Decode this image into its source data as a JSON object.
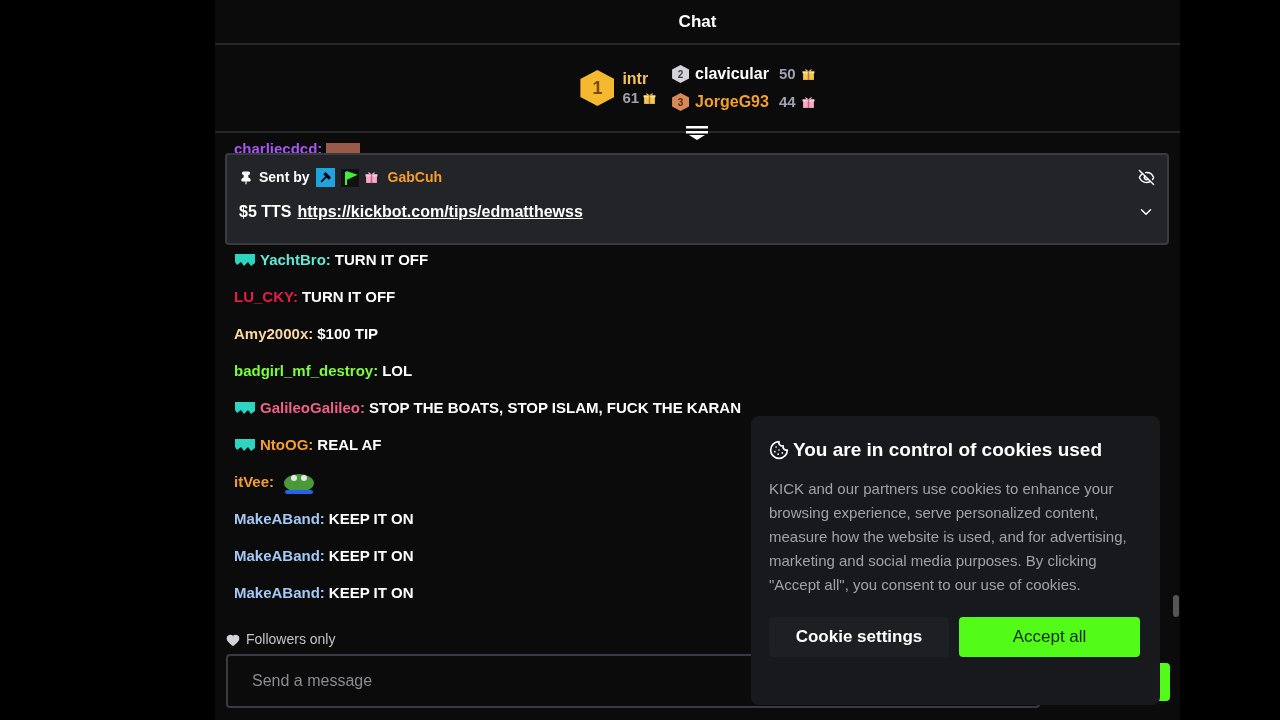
{
  "header": {
    "title": "Chat"
  },
  "leaderboard": [
    {
      "rank": "1",
      "name": "intr",
      "count": "61",
      "color": "#f5c451"
    },
    {
      "rank": "2",
      "name": "clavicular",
      "count": "50",
      "color": "#ffffff"
    },
    {
      "rank": "3",
      "name": "JorgeG93",
      "count": "44",
      "color": "#f59e2b"
    }
  ],
  "pinned": {
    "sent_by": "Sent by",
    "user": "GabCuh",
    "message": "$5 TTS",
    "link": "https://kickbot.com/tips/edmatthewss"
  },
  "hidden_message": {
    "user": "charliecdcd:",
    "color": "#a855f7"
  },
  "messages": [
    {
      "kind": "text",
      "badge": true,
      "user": "YachtBro:",
      "color": "#5eead4",
      "text": "TURN IT OFF"
    },
    {
      "kind": "text",
      "badge": false,
      "user": "LU_CKY:",
      "color": "#e11d48",
      "text": "TURN IT OFF"
    },
    {
      "kind": "text",
      "badge": false,
      "user": "Amy2000x:",
      "color": "#fcd9a0",
      "text": "$100 TIP"
    },
    {
      "kind": "text",
      "badge": false,
      "user": "badgirl_mf_destroy:",
      "color": "#7cfc3a",
      "text": "LOL"
    },
    {
      "kind": "text",
      "badge": true,
      "user": "GalileoGalileo:",
      "color": "#f0608a",
      "text": "STOP THE BOATS, STOP ISLAM, FUCK THE KARAN"
    },
    {
      "kind": "text",
      "badge": true,
      "user": "NtoOG:",
      "color": "#f59e2b",
      "text": "REAL AF"
    },
    {
      "kind": "emote",
      "badge": false,
      "user": "itVee:",
      "color": "#f59e2b"
    },
    {
      "kind": "text",
      "badge": false,
      "user": "MakeABand:",
      "color": "#a5c8f5",
      "text": "KEEP IT ON"
    },
    {
      "kind": "text",
      "badge": false,
      "user": "MakeABand:",
      "color": "#a5c8f5",
      "text": "KEEP IT ON"
    },
    {
      "kind": "text",
      "badge": false,
      "user": "MakeABand:",
      "color": "#a5c8f5",
      "text": "KEEP IT ON"
    }
  ],
  "chat_mode": "Followers only",
  "input": {
    "placeholder": "Send a message"
  },
  "cookie_dialog": {
    "title": "You are in control of cookies used",
    "body": "KICK and our partners use cookies to enhance your browsing experience, serve personalized content, measure how the website is used, and for advertising, marketing and social media purposes. By clicking \"Accept all\", you consent to our use of cookies.",
    "buttons": [
      "Cookie settings",
      "Accept all"
    ]
  }
}
